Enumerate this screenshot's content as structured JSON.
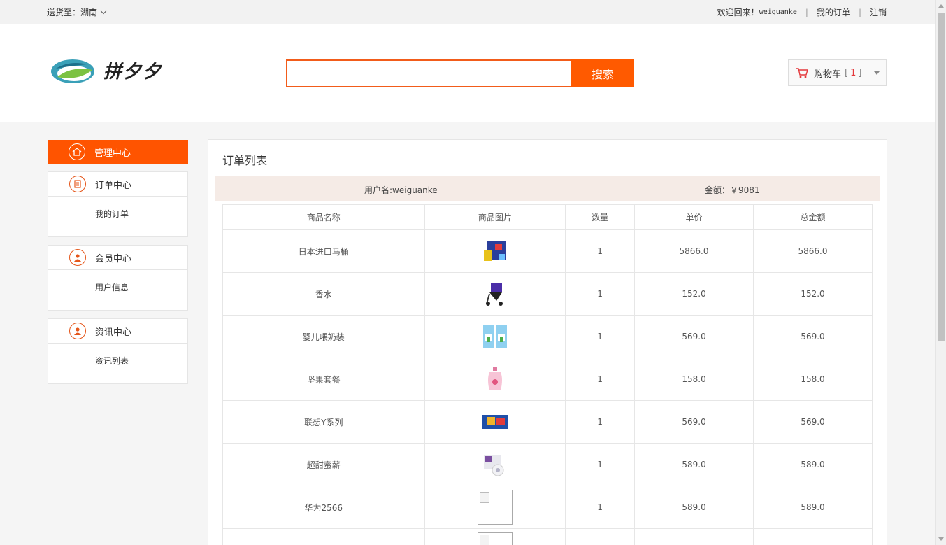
{
  "topbar": {
    "ship_to": "送货至：湖南",
    "welcome": "欢迎回来！",
    "username": "weiguanke",
    "my_orders": "我的订单",
    "logout": "注销"
  },
  "header": {
    "logo_text": "拼夕夕",
    "search_placeholder": "",
    "search_button": "搜索",
    "cart_label": "购物车",
    "cart_count_open": "[",
    "cart_count": "1",
    "cart_count_close": "]"
  },
  "sidebar": {
    "active_label": "管理中心",
    "sections": [
      {
        "title": "订单中心",
        "item": "我的订单"
      },
      {
        "title": "会员中心",
        "item": "用户信息"
      },
      {
        "title": "资讯中心",
        "item": "资讯列表"
      }
    ]
  },
  "main": {
    "title": "订单列表",
    "user_label": "用户名:weiguanke",
    "amount_label": "金额：￥9081",
    "columns": [
      "商品名称",
      "商品图片",
      "数量",
      "单价",
      "总金额"
    ],
    "rows": [
      {
        "name": "日本进口马桶",
        "image": "product-box-image",
        "qty": "1",
        "price": "5866.0",
        "total": "5866.0"
      },
      {
        "name": "香水",
        "image": "stroller-image",
        "qty": "1",
        "price": "152.0",
        "total": "152.0"
      },
      {
        "name": "婴儿喂奶装",
        "image": "milk-powder-image",
        "qty": "1",
        "price": "569.0",
        "total": "569.0"
      },
      {
        "name": "坚果套餐",
        "image": "detergent-bottle-image",
        "qty": "1",
        "price": "158.0",
        "total": "158.0"
      },
      {
        "name": "联想Y系列",
        "image": "snack-pack-image",
        "qty": "1",
        "price": "569.0",
        "total": "569.0"
      },
      {
        "name": "超甜蜜薪",
        "image": "toy-box-image",
        "qty": "1",
        "price": "589.0",
        "total": "589.0"
      },
      {
        "name": "华为2566",
        "image": "broken-image",
        "qty": "1",
        "price": "589.0",
        "total": "589.0"
      },
      {
        "name": "",
        "image": "broken-image",
        "qty": "",
        "price": "",
        "total": ""
      }
    ]
  },
  "colors": {
    "accent": "#ff5400",
    "search_border": "#f25c1a",
    "info_bg": "#f5ebe6"
  }
}
